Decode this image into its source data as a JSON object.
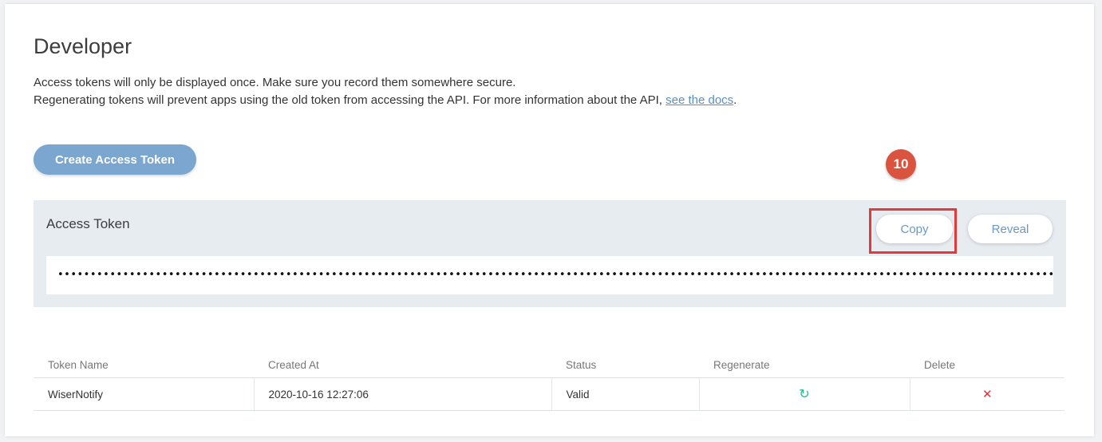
{
  "page": {
    "title": "Developer",
    "desc_line1": "Access tokens will only be displayed once. Make sure you record them somewhere secure.",
    "desc_line2_prefix": "Regenerating tokens will prevent apps using the old token from accessing the API. For more information about the API, ",
    "docs_link": "see the docs",
    "desc_line2_suffix": "."
  },
  "actions": {
    "create_token_label": "Create Access Token"
  },
  "annotation": {
    "step_number": "10"
  },
  "token_panel": {
    "label": "Access Token",
    "copy_label": "Copy",
    "reveal_label": "Reveal",
    "masked_value": "••••••••••••••••••••••••••••••••••••••••••••••••••••••••••••••••••••••••••••••••••••••••••••••••••••••••••••••••••••••••••••••••••••••••••••••••••••••••••••••••••••••••••••••••••••••••••••••••••••••••••••••••••••••••••••••"
  },
  "table": {
    "headers": [
      "Token Name",
      "Created At",
      "Status",
      "Regenerate",
      "Delete"
    ],
    "rows": [
      {
        "token_name": "WiserNotify",
        "created_at": "2020-10-16 12:27:06",
        "status": "Valid",
        "regenerate_icon": "refresh-icon",
        "delete_icon": "close-icon"
      }
    ]
  },
  "colors": {
    "accent": "#7aa6cf",
    "link": "#5b8fbd",
    "badge": "#d9533e",
    "highlight": "#e03a3a",
    "regenerate": "#2cb88f",
    "delete": "#d9373f"
  }
}
